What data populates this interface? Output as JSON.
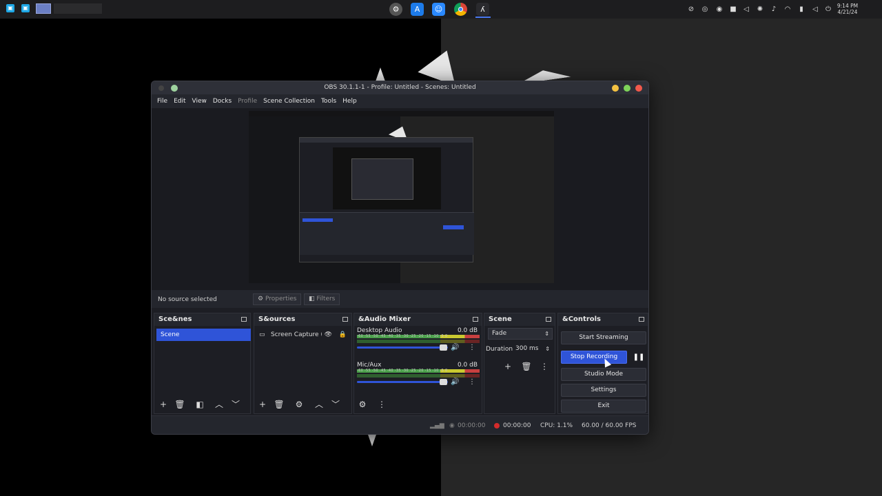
{
  "window_title": "OBS 30.1.1-1 - Profile: Untitled - Scenes: Untitled",
  "menu": [
    "File",
    "Edit",
    "View",
    "Docks",
    "Profile",
    "Scene Collection",
    "Tools",
    "Help"
  ],
  "source_bar": {
    "status": "No source selected",
    "properties_label": "Properties",
    "filters_label": "Filters"
  },
  "docks": {
    "scenes": {
      "title": "Sce&nes",
      "items": [
        "Scene"
      ]
    },
    "sources": {
      "title": "S&ources",
      "items": [
        "Screen Capture (PipeW"
      ]
    },
    "mixer": {
      "title": "&Audio Mixer",
      "channels": [
        {
          "name": "Desktop Audio",
          "db": "0.0 dB"
        },
        {
          "name": "Mic/Aux",
          "db": "0.0 dB"
        }
      ],
      "ticks": "-60 -55 -50 -45 -40 -35 -30 -25 -20 -15 -10 -5 0"
    },
    "transitions": {
      "title": "Scene T&ransiti...",
      "selected": "Fade",
      "duration_label": "Duration",
      "duration_value": "300 ms"
    },
    "controls": {
      "title": "&Controls",
      "start_streaming": "Start Streaming",
      "stop_recording": "Stop Recording",
      "studio_mode": "Studio Mode",
      "settings": "Settings",
      "exit": "Exit"
    }
  },
  "status": {
    "stream_time": "00:00:00",
    "rec_time": "00:00:00",
    "cpu": "CPU: 1.1%",
    "fps": "60.00 / 60.00 FPS"
  },
  "clock": {
    "time": "9:14 PM",
    "date": "4/21/24"
  },
  "colors": {
    "accent": "#2f54d8",
    "record": "#d42b2b",
    "bg_dark": "#1d1e24"
  }
}
